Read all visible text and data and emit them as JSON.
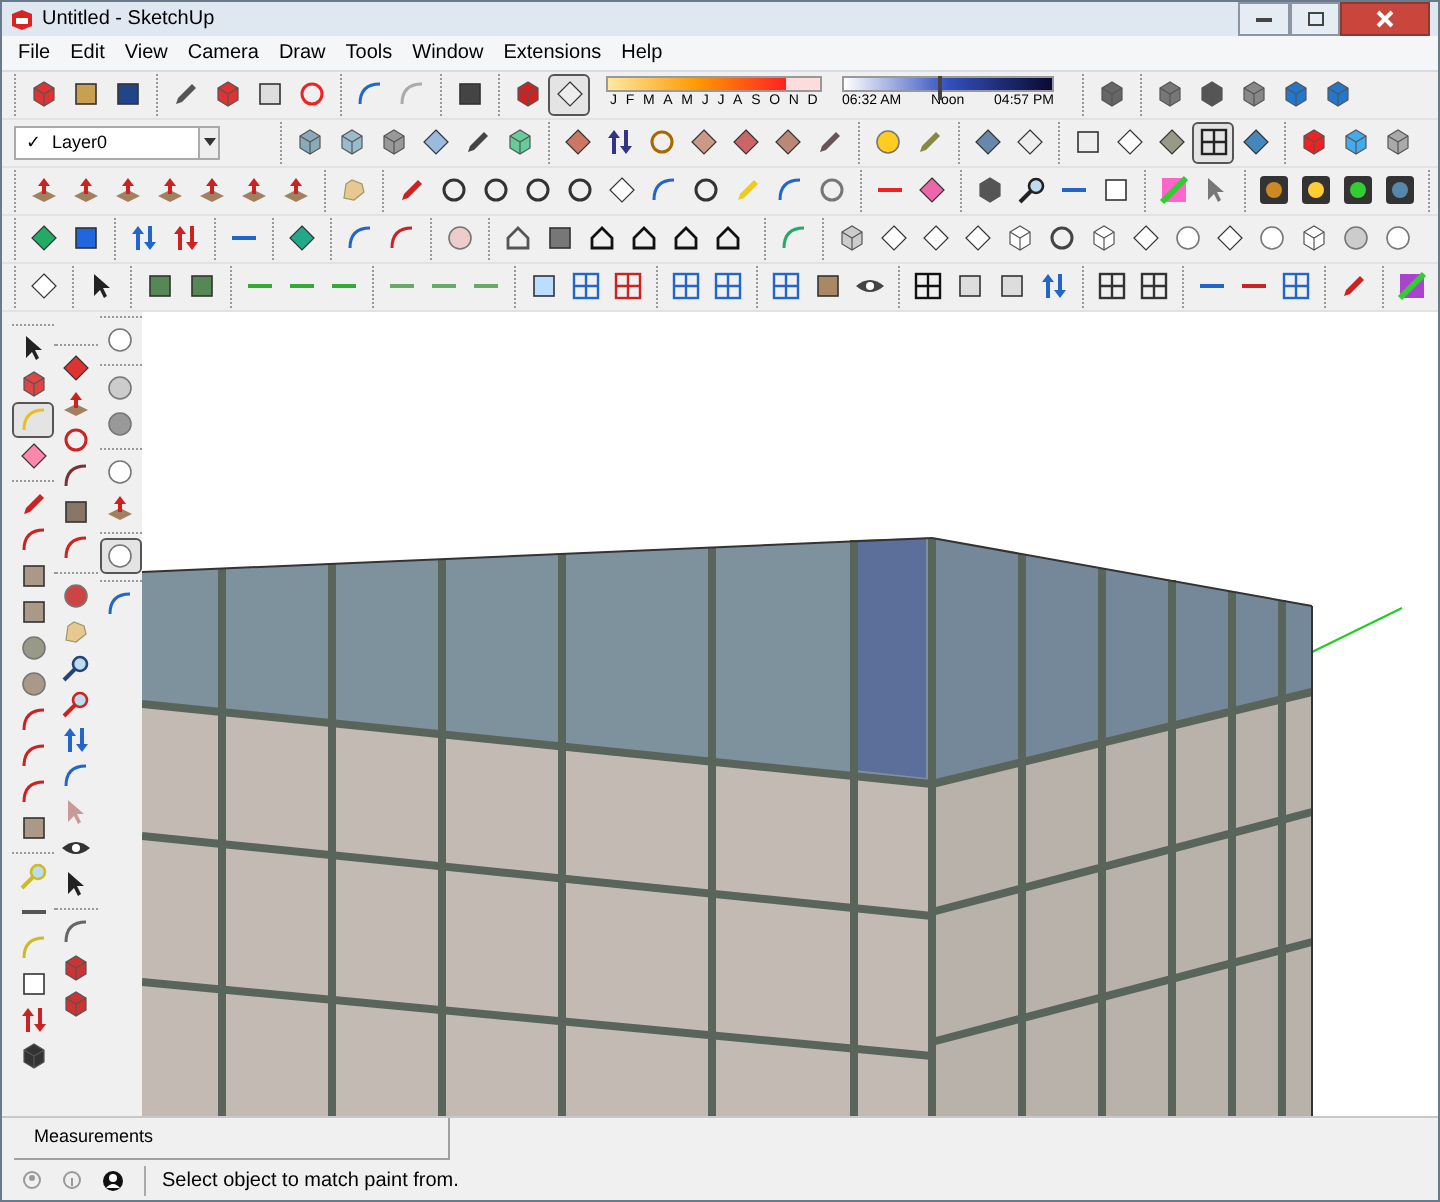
{
  "window": {
    "title": "Untitled - SketchUp"
  },
  "menu": [
    {
      "label": "File"
    },
    {
      "label": "Edit"
    },
    {
      "label": "View"
    },
    {
      "label": "Camera"
    },
    {
      "label": "Draw"
    },
    {
      "label": "Tools"
    },
    {
      "label": "Window"
    },
    {
      "label": "Extensions"
    },
    {
      "label": "Help"
    }
  ],
  "shadow_settings": {
    "months": [
      "J",
      "F",
      "M",
      "A",
      "M",
      "J",
      "J",
      "A",
      "S",
      "O",
      "N",
      "D"
    ],
    "date_slider": {
      "level": 0.84
    },
    "time_slider": {
      "level": 0.45
    },
    "sunrise": "06:32 AM",
    "noon": "Noon",
    "sunset": "04:57 PM"
  },
  "layer_dropdown": {
    "check": "✓",
    "value": "Layer0"
  },
  "measurements": {
    "label": "Measurements"
  },
  "status_bar": {
    "message": "Select object to match paint from."
  }
}
